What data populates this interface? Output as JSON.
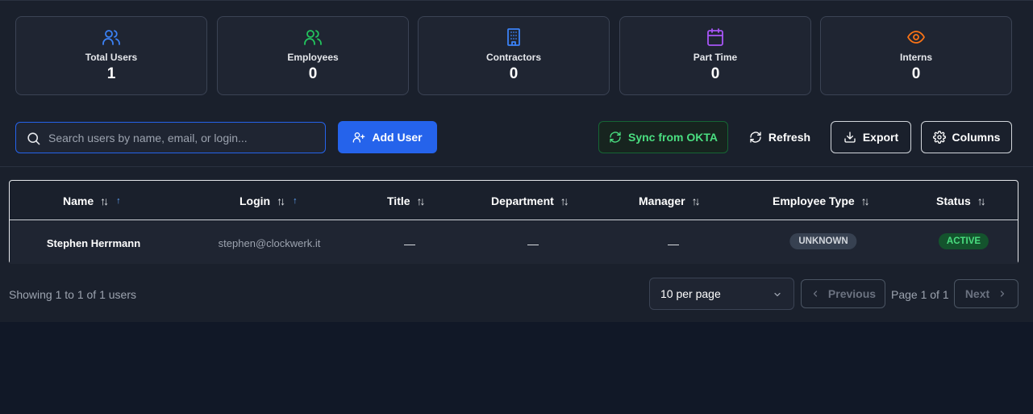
{
  "stats": [
    {
      "label": "Total Users",
      "value": "1",
      "icon": "users-icon",
      "color": "#3b82f6"
    },
    {
      "label": "Employees",
      "value": "0",
      "icon": "users-icon",
      "color": "#22c55e"
    },
    {
      "label": "Contractors",
      "value": "0",
      "icon": "building-icon",
      "color": "#3b82f6"
    },
    {
      "label": "Part Time",
      "value": "0",
      "icon": "calendar-icon",
      "color": "#a855f7"
    },
    {
      "label": "Interns",
      "value": "0",
      "icon": "eye-icon",
      "color": "#f97316"
    }
  ],
  "toolbar": {
    "search_placeholder": "Search users by name, email, or login...",
    "search_value": "",
    "add_user": "Add User",
    "sync": "Sync from OKTA",
    "refresh": "Refresh",
    "export": "Export",
    "columns": "Columns"
  },
  "table": {
    "columns": [
      "Name",
      "Login",
      "Title",
      "Department",
      "Manager",
      "Employee Type",
      "Status"
    ],
    "sorted_columns": [
      "Name",
      "Login"
    ],
    "rows": [
      {
        "name": "Stephen Herrmann",
        "login": "stephen@clockwerk.it",
        "title": "—",
        "department": "—",
        "manager": "—",
        "employee_type": "UNKNOWN",
        "status": "ACTIVE"
      }
    ]
  },
  "pagination": {
    "showing": "Showing 1 to 1 of 1 users",
    "per_page": "10 per page",
    "previous": "Previous",
    "page_info": "Page 1 of 1",
    "next": "Next"
  },
  "colors": {
    "accent": "#2563eb",
    "success": "#4ade80",
    "background": "#111827",
    "panel": "#1a202c"
  }
}
